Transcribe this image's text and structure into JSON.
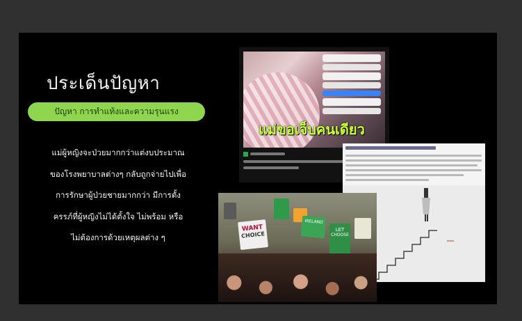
{
  "slide": {
    "title": "ประเด็นปัญหา",
    "subtitle": "ปัญหา การทำแท้งและความรุนแรง",
    "body_lines": [
      "แม่ผู้หญิงจะป่วยมากกว่าแต่งบประมาณ",
      "ของโรงพยาบาลต่างๆ กลับถูกจ่ายไปเพื่อ",
      "การรักษาผู้ป่วยชายมากกว่า มีการตั้ง",
      "ครรภ์ที่ผู้หญิงไม่ได้ตั้งใจ ไม่พร้อม หรือ",
      "ไม่ต้องการด้วยเหตุผลต่าง ๆ"
    ]
  },
  "news_image": {
    "headline": "แม่ขอเจ็บคนเดียว"
  },
  "protest_signs": [
    "WANT",
    "CHOICE",
    "IRELAND",
    "LET",
    "CHOOSE"
  ],
  "colors": {
    "pill_bg": "#8fd64e",
    "headline": "#c8ff3a",
    "slide_bg": "#000000"
  }
}
